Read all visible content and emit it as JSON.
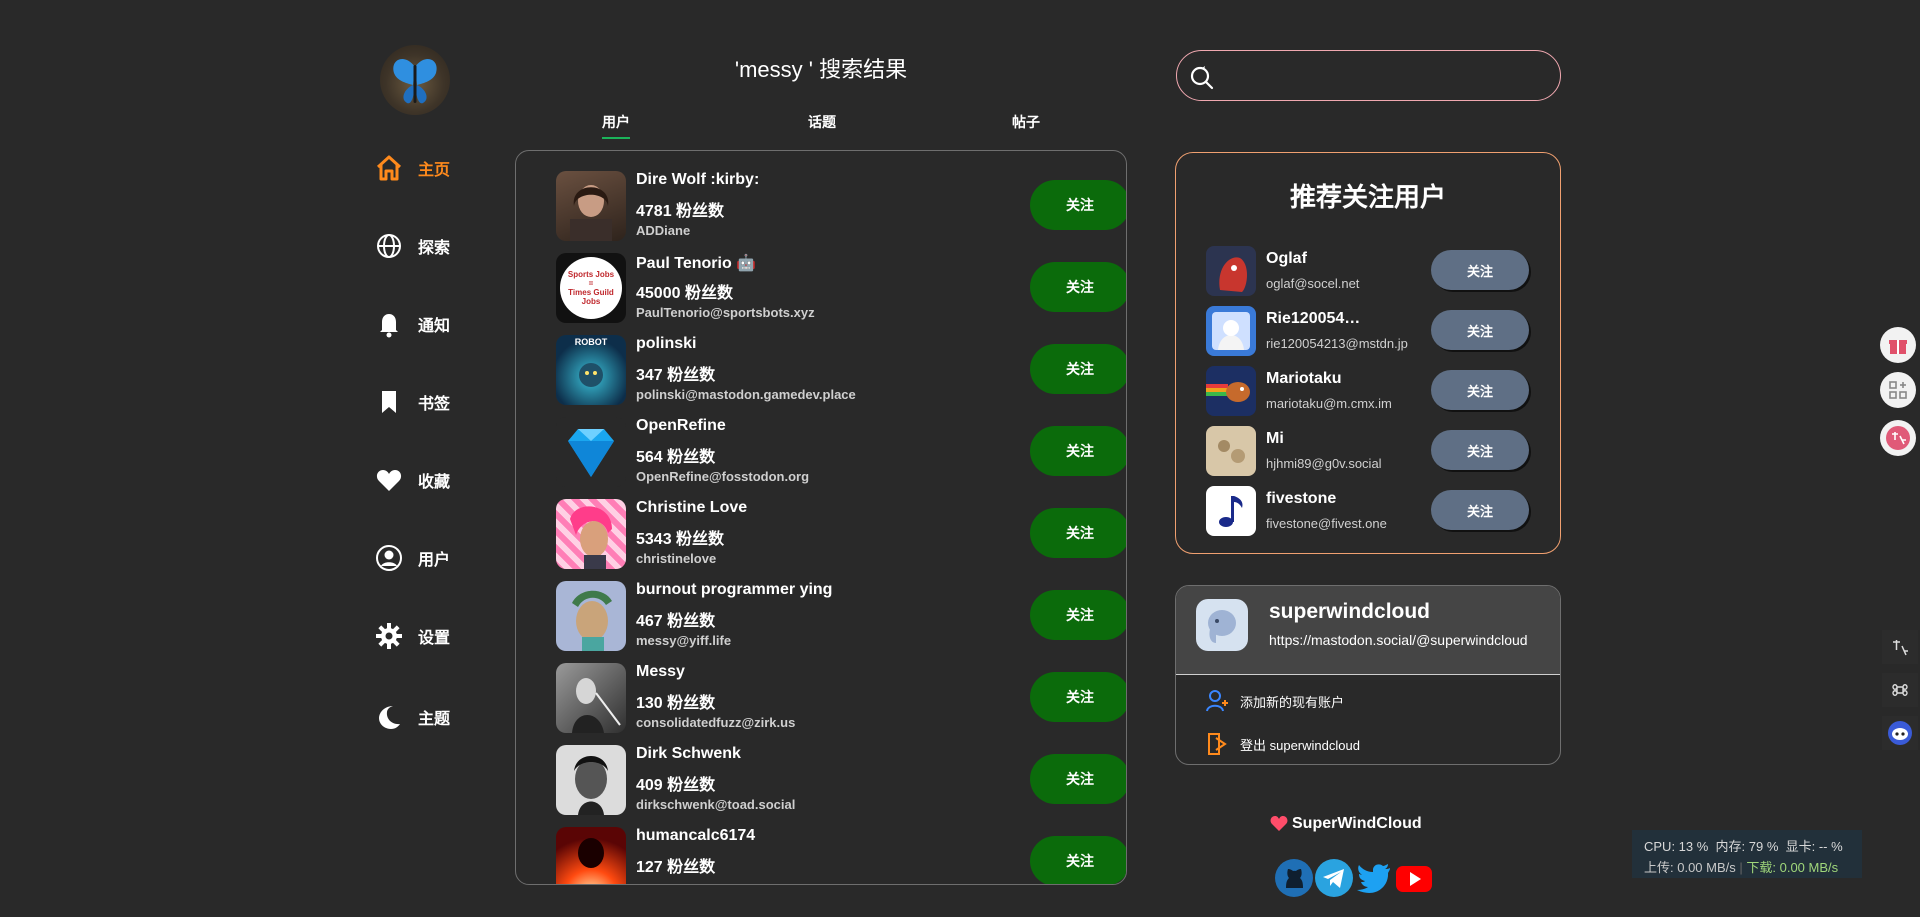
{
  "header": {
    "search_title": "'messy ' 搜索结果",
    "tabs": [
      {
        "label": "用户",
        "active": true
      },
      {
        "label": "话题",
        "active": false
      },
      {
        "label": "帖子",
        "active": false
      }
    ]
  },
  "nav": {
    "items": [
      {
        "label": "主页",
        "icon": "home-icon",
        "active": true
      },
      {
        "label": "探索",
        "icon": "globe-icon"
      },
      {
        "label": "通知",
        "icon": "bell-icon"
      },
      {
        "label": "书签",
        "icon": "bookmark-icon"
      },
      {
        "label": "收藏",
        "icon": "heart-icon"
      },
      {
        "label": "用户",
        "icon": "user-icon"
      },
      {
        "label": "设置",
        "icon": "gear-icon"
      },
      {
        "label": "主题",
        "icon": "moon-icon"
      }
    ]
  },
  "results": {
    "follow_label": "关注",
    "users": [
      {
        "name": "Dire Wolf :kirby:",
        "fans": "4781 粉丝数",
        "handle": "ADDiane"
      },
      {
        "name": "Paul Tenorio 🤖",
        "fans": "45000 粉丝数",
        "handle": "PaulTenorio@sportsbots.xyz"
      },
      {
        "name": "polinski",
        "fans": "347 粉丝数",
        "handle": "polinski@mastodon.gamedev.place"
      },
      {
        "name": "OpenRefine",
        "fans": "564 粉丝数",
        "handle": "OpenRefine@fosstodon.org"
      },
      {
        "name": "Christine Love",
        "fans": "5343 粉丝数",
        "handle": "christinelove"
      },
      {
        "name": "burnout programmer ying",
        "fans": "467 粉丝数",
        "handle": "messy@yiff.life"
      },
      {
        "name": "Messy",
        "fans": "130 粉丝数",
        "handle": "consolidatedfuzz@zirk.us"
      },
      {
        "name": "Dirk Schwenk",
        "fans": "409 粉丝数",
        "handle": "dirkschwenk@toad.social"
      },
      {
        "name": "humancalc6174",
        "fans": "127 粉丝数",
        "handle": ""
      }
    ],
    "avatar_texts": {
      "paul": [
        "Sports Jobs",
        "=",
        "Times Guild",
        "Jobs"
      ],
      "polinski": "ROBOT"
    }
  },
  "search": {
    "placeholder": "",
    "value": ""
  },
  "suggest": {
    "title": "推荐关注用户",
    "follow_label": "关注",
    "users": [
      {
        "name": "Oglaf",
        "handle": "oglaf@socel.net"
      },
      {
        "name": "Rie120054…",
        "handle": "rie120054213@mstdn.jp"
      },
      {
        "name": "Mariotaku",
        "handle": "mariotaku@m.cmx.im"
      },
      {
        "name": "Mi",
        "handle": "hjhmi89@g0v.social"
      },
      {
        "name": "fivestone",
        "handle": "fivestone@fivest.one"
      }
    ]
  },
  "account": {
    "name": "superwindcloud",
    "url": "https://mastodon.social/@superwindcloud",
    "add_account": "添加新的现有账户",
    "logout": "登出 superwindcloud"
  },
  "footer": {
    "brand": "SuperWindCloud",
    "social": [
      "github-icon",
      "telegram-icon",
      "twitter-icon",
      "youtube-icon"
    ]
  },
  "sysmon": {
    "line1": "CPU: 13 %  内存: 79 %  显卡: -- %",
    "upload": "上传: 0.00 MB/s",
    "download": "下载: 0.00 MB/s"
  },
  "colors": {
    "background": "#292929",
    "accent_orange": "#ff8a1c",
    "follow_green": "#0b6b0b",
    "suggest_follow": "#5f6f85",
    "tab_underline": "#1bb35a"
  }
}
